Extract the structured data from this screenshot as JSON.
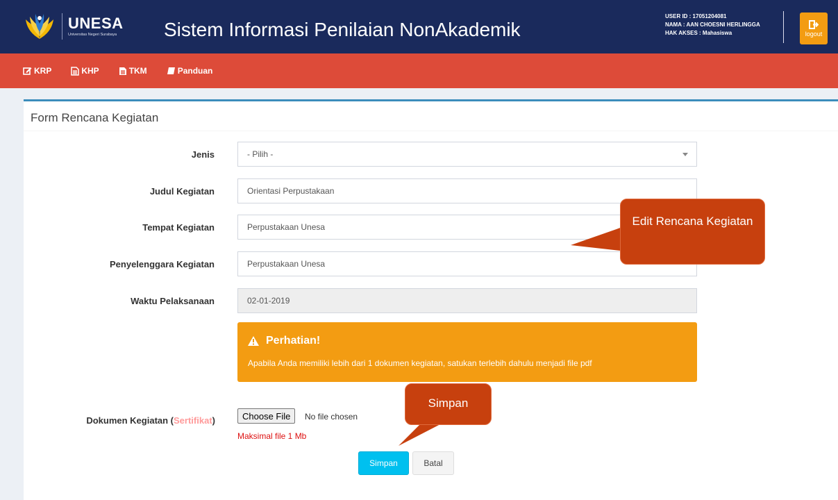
{
  "header": {
    "logo_title": "UNESA",
    "logo_subtitle": "Universitas Negeri Surabaya",
    "app_title": "Sistem Informasi Penilaian NonAkademik",
    "user_id": "USER ID : 17051204081",
    "user_name": "NAMA : AAN CHOESNI HERLINGGA",
    "user_role": "HAK AKSES : Mahasiswa",
    "logout_label": "logout"
  },
  "nav": {
    "items": [
      {
        "label": "KRP",
        "icon": "edit-icon"
      },
      {
        "label": "KHP",
        "icon": "file-text-icon"
      },
      {
        "label": "TKM",
        "icon": "file-icon"
      },
      {
        "label": "Panduan",
        "icon": "book-icon"
      }
    ]
  },
  "form": {
    "title": "Form Rencana Kegiatan",
    "jenis_label": "Jenis",
    "jenis_value": "- Pilih -",
    "judul_label": "Judul Kegiatan",
    "judul_value": "Orientasi Perpustakaan",
    "tempat_label": "Tempat Kegiatan",
    "tempat_value": "Perpustakaan Unesa",
    "penyelenggara_label": "Penyelenggara Kegiatan",
    "penyelenggara_value": "Perpustakaan Unesa",
    "waktu_label": "Waktu Pelaksanaan",
    "waktu_value": "02-01-2019",
    "alert_title": "Perhatian!",
    "alert_message": "Apabila Anda memiliki lebih dari 1 dokumen kegiatan, satukan terlebih dahulu menjadi file pdf",
    "dokumen_label": "Dokumen Kegiatan (",
    "dokumen_highlight": "Sertifikat",
    "dokumen_close": ")",
    "choose_file_label": "Choose File",
    "file_status": "No file chosen",
    "max_note": "Maksimal file 1 Mb",
    "simpan_label": "Simpan",
    "batal_label": "Batal"
  },
  "callouts": {
    "edit": "Edit Rencana Kegiatan",
    "simpan": "Simpan"
  },
  "colors": {
    "header_bg": "#1a2a5c",
    "nav_bg": "#dd4b39",
    "accent_blue": "#3c8dbc",
    "warning": "#f39c12",
    "info_button": "#00c0ef",
    "callout": "#c7400e"
  }
}
